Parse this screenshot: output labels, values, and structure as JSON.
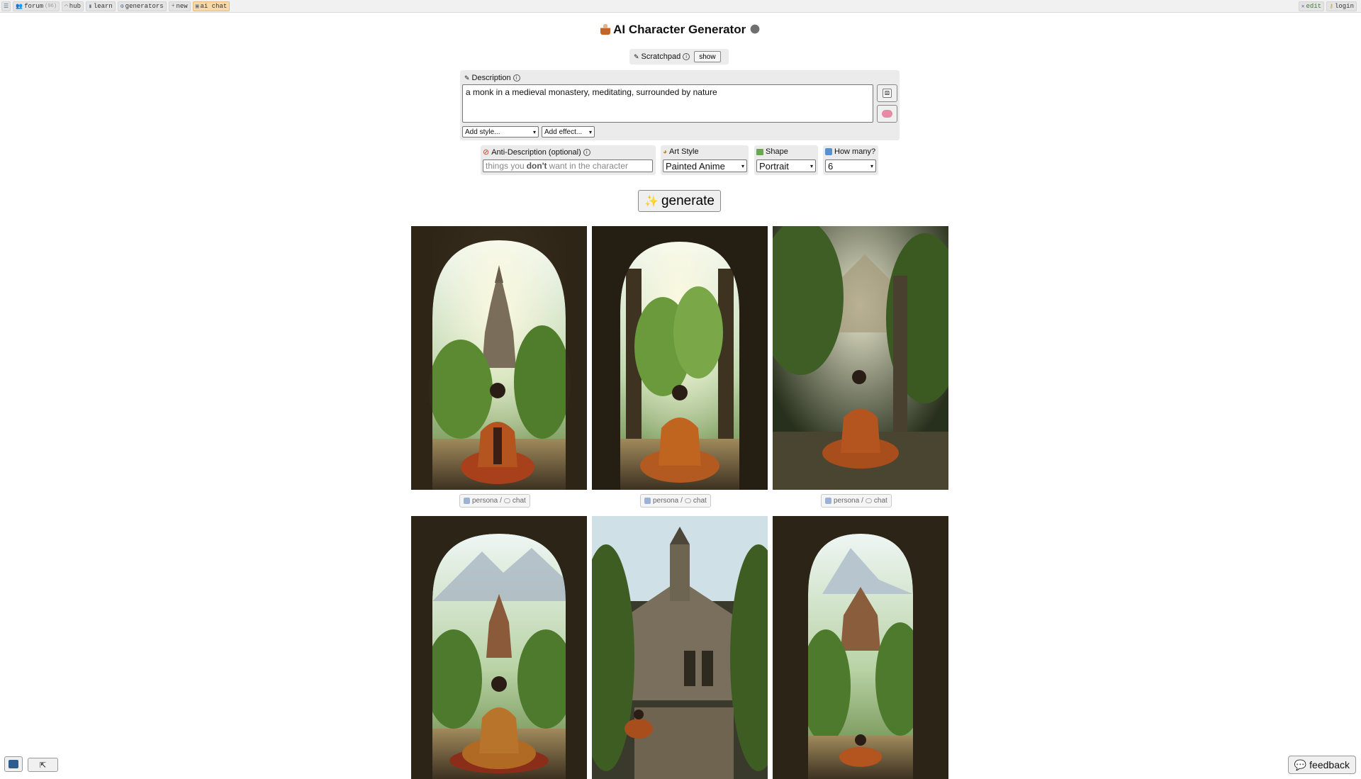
{
  "nav": {
    "menu_icon": "menu-icon",
    "items": [
      {
        "label": "forum",
        "count": "(96)",
        "icon": "people-icon"
      },
      {
        "label": "hub",
        "icon": "rainbow-icon"
      },
      {
        "label": "learn",
        "icon": "book-icon"
      },
      {
        "label": "generators",
        "icon": "gear-icon"
      },
      {
        "label": "new",
        "icon": "plus-icon"
      },
      {
        "label": "ai chat",
        "icon": "chat-icon"
      }
    ],
    "right": [
      {
        "label": "edit",
        "icon": "tools-icon"
      },
      {
        "label": "login",
        "icon": "key-icon"
      }
    ]
  },
  "title": "AI Character Generator",
  "scratchpad": {
    "label": "Scratchpad",
    "info": "ⓘ",
    "button": "show"
  },
  "description": {
    "label": "Description",
    "info": "ⓘ",
    "value": "a monk in a medieval monastery, meditating, surrounded by nature",
    "style_select": "Add style...",
    "effect_select": "Add effect..."
  },
  "anti_description": {
    "label": "Anti-Description (optional)",
    "info": "ⓘ",
    "placeholder_pre": "things you",
    "placeholder_bold": "don't",
    "placeholder_post": "want in the character"
  },
  "art_style": {
    "label": "Art Style",
    "value": "Painted Anime"
  },
  "shape": {
    "label": "Shape",
    "value": "Portrait"
  },
  "how_many": {
    "label": "How many?",
    "value": "6"
  },
  "generate": {
    "label": "generate",
    "icon": "sparkles-icon"
  },
  "result_buttons": {
    "persona": "persona",
    "sep": "/",
    "chat": "chat"
  },
  "feedback": {
    "label": "feedback",
    "icon": "speech-bubble-icon"
  },
  "colors": {
    "panel": "#ebebeb",
    "robe": "#b4541e",
    "foliage": "#4d7a2c",
    "stone": "#3b2f22",
    "sky": "#dfeef2"
  }
}
